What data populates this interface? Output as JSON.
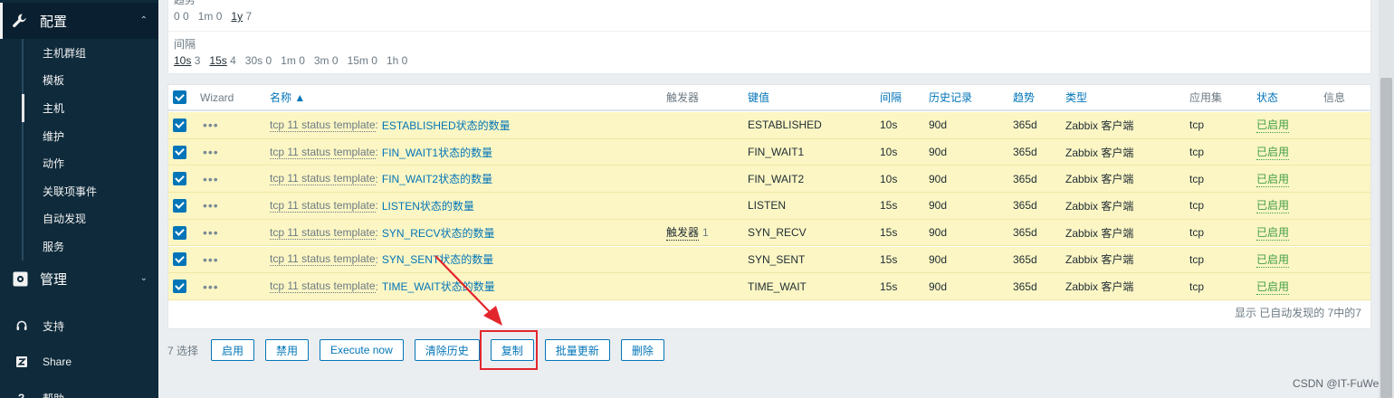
{
  "sidebar": {
    "config_section": "配置",
    "config_items": [
      "主机群组",
      "模板",
      "主机",
      "维护",
      "动作",
      "关联项事件",
      "自动发现",
      "服务"
    ],
    "active_index": 2,
    "admin_section": "管理",
    "support": "支持",
    "share": "Share",
    "help": "帮助"
  },
  "filter": {
    "trend_title": "趋势",
    "trend_values": [
      {
        "key": "0",
        "count": "0",
        "selected": false
      },
      {
        "key": "1m",
        "count": "0",
        "selected": false
      },
      {
        "key": "1y",
        "count": "7",
        "selected": true
      }
    ],
    "interval_title": "间隔",
    "interval_values": [
      {
        "key": "10s",
        "count": "3",
        "selected": true
      },
      {
        "key": "15s",
        "count": "4",
        "selected": true
      },
      {
        "key": "30s",
        "count": "0",
        "selected": false
      },
      {
        "key": "1m",
        "count": "0",
        "selected": false
      },
      {
        "key": "3m",
        "count": "0",
        "selected": false
      },
      {
        "key": "15m",
        "count": "0",
        "selected": false
      },
      {
        "key": "1h",
        "count": "0",
        "selected": false
      }
    ]
  },
  "table": {
    "headers": {
      "wizard": "Wizard",
      "name": "名称 ▲",
      "triggers": "触发器",
      "key": "键值",
      "interval": "间隔",
      "history": "历史记录",
      "trends": "趋势",
      "type": "类型",
      "app": "应用集",
      "status": "状态",
      "info": "信息"
    },
    "rows": [
      {
        "template": "tcp 11 status template",
        "name": "ESTABLISHED状态的数量",
        "triggers": "",
        "trigger_count": "",
        "key": "ESTABLISHED",
        "interval": "10s",
        "history": "90d",
        "trends": "365d",
        "type": "Zabbix 客户端",
        "app": "tcp",
        "status": "已启用"
      },
      {
        "template": "tcp 11 status template",
        "name": "FIN_WAIT1状态的数量",
        "triggers": "",
        "trigger_count": "",
        "key": "FIN_WAIT1",
        "interval": "10s",
        "history": "90d",
        "trends": "365d",
        "type": "Zabbix 客户端",
        "app": "tcp",
        "status": "已启用"
      },
      {
        "template": "tcp 11 status template",
        "name": "FIN_WAIT2状态的数量",
        "triggers": "",
        "trigger_count": "",
        "key": "FIN_WAIT2",
        "interval": "10s",
        "history": "90d",
        "trends": "365d",
        "type": "Zabbix 客户端",
        "app": "tcp",
        "status": "已启用"
      },
      {
        "template": "tcp 11 status template",
        "name": "LISTEN状态的数量",
        "triggers": "",
        "trigger_count": "",
        "key": "LISTEN",
        "interval": "15s",
        "history": "90d",
        "trends": "365d",
        "type": "Zabbix 客户端",
        "app": "tcp",
        "status": "已启用"
      },
      {
        "template": "tcp 11 status template",
        "name": "SYN_RECV状态的数量",
        "triggers": "触发器",
        "trigger_count": "1",
        "key": "SYN_RECV",
        "interval": "15s",
        "history": "90d",
        "trends": "365d",
        "type": "Zabbix 客户端",
        "app": "tcp",
        "status": "已启用"
      },
      {
        "template": "tcp 11 status template",
        "name": "SYN_SENT状态的数量",
        "triggers": "",
        "trigger_count": "",
        "key": "SYN_SENT",
        "interval": "15s",
        "history": "90d",
        "trends": "365d",
        "type": "Zabbix 客户端",
        "app": "tcp",
        "status": "已启用"
      },
      {
        "template": "tcp 11 status template",
        "name": "TIME_WAIT状态的数量",
        "triggers": "",
        "trigger_count": "",
        "key": "TIME_WAIT",
        "interval": "15s",
        "history": "90d",
        "trends": "365d",
        "type": "Zabbix 客户端",
        "app": "tcp",
        "status": "已启用"
      }
    ],
    "footer": "显示 已自动发现的 7中的7"
  },
  "actions": {
    "selected_count": "7 选择",
    "enable": "启用",
    "disable": "禁用",
    "execute_now": "Execute now",
    "clear_history": "清除历史",
    "copy": "复制",
    "mass_update": "批量更新",
    "delete": "删除"
  },
  "watermark": "CSDN @IT-FuWei",
  "colors": {
    "sidebar_bg": "#0e2a3b",
    "link_blue": "#0275b8",
    "row_highlight": "#fcf6c4",
    "status_green": "#429e47",
    "annotation_red": "#e3262d"
  }
}
